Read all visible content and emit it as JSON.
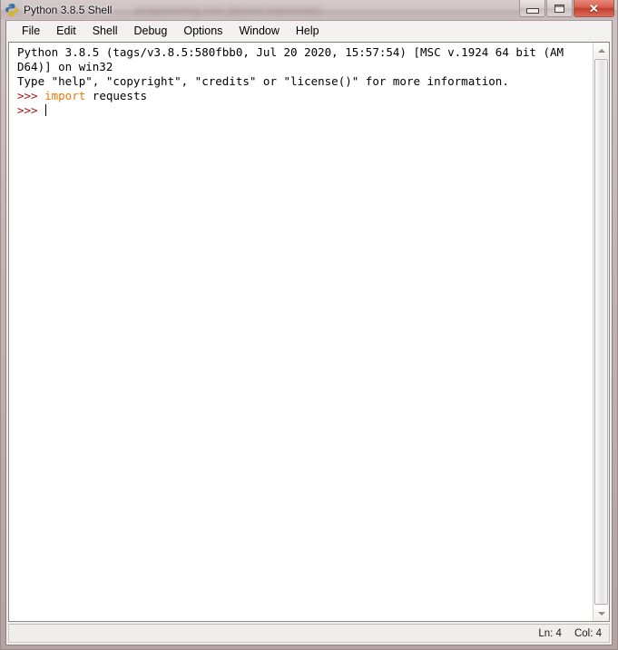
{
  "window": {
    "title": "Python 3.8.5 Shell",
    "icon": "python-logo-icon",
    "ghost_text": "programming.com (blurred watermark)",
    "controls": {
      "minimize_label": "Minimize",
      "maximize_label": "Maximize",
      "close_label": "Close",
      "close_glyph": "✕"
    },
    "frame_color": "#c3b4b4",
    "titlebar_color": "#cec2c2"
  },
  "menubar": {
    "items": [
      {
        "label": "File"
      },
      {
        "label": "Edit"
      },
      {
        "label": "Shell"
      },
      {
        "label": "Debug"
      },
      {
        "label": "Options"
      },
      {
        "label": "Window"
      },
      {
        "label": "Help"
      }
    ]
  },
  "console": {
    "background": "#ffffff",
    "banner_color": "#000000",
    "prompt_color": "#aa1111",
    "keyword_color": "#ee7700",
    "lines": {
      "banner_1": "Python 3.8.5 (tags/v3.8.5:580fbb0, Jul 20 2020, 15:57:54) [MSC v.1924 64 bit (AM",
      "banner_2": "D64)] on win32",
      "banner_3": "Type \"help\", \"copyright\", \"credits\" or \"license()\" for more information.",
      "prompt_1": ">>> ",
      "keyword_1": "import",
      "code_1": " requests",
      "prompt_2": ">>> "
    }
  },
  "scrollbar": {
    "up_arrow": "arrow-up-icon",
    "down_arrow": "arrow-down-icon",
    "thumb_position": "full"
  },
  "statusbar": {
    "line": "Ln: 4",
    "column": "Col: 4"
  }
}
